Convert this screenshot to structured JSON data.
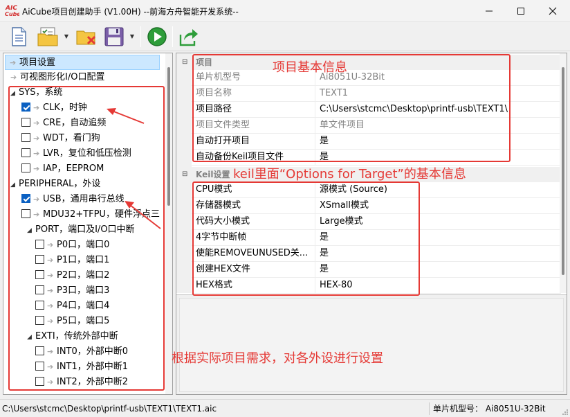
{
  "window": {
    "logo_text_top": "AIC",
    "logo_text_bottom": "Cube",
    "title": "AiCube项目创建助手 (V1.00H) --前海方舟智能开发系统--"
  },
  "toolbar": {
    "buttons": [
      {
        "name": "new-project",
        "icon": "new-document-icon"
      },
      {
        "name": "open-project",
        "icon": "open-folder-checklist-icon"
      },
      {
        "name": "close-project",
        "icon": "folder-delete-icon"
      },
      {
        "name": "save-project",
        "icon": "floppy-disk-icon"
      },
      {
        "name": "generate",
        "icon": "play-green-icon"
      },
      {
        "name": "export",
        "icon": "export-share-icon"
      }
    ]
  },
  "tree": {
    "items": [
      {
        "label": "项目设置",
        "level": 0,
        "type": "link",
        "selected": true
      },
      {
        "label": "可视图形化I/O口配置",
        "level": 0,
        "type": "link"
      },
      {
        "label": "SYS，系统",
        "level": 0,
        "type": "group"
      },
      {
        "label": "CLK，时钟",
        "level": 1,
        "type": "check",
        "checked": true
      },
      {
        "label": "CRE，自动追频",
        "level": 1,
        "type": "check",
        "checked": false
      },
      {
        "label": "WDT，看门狗",
        "level": 1,
        "type": "check",
        "checked": false
      },
      {
        "label": "LVR，复位和低压检测",
        "level": 1,
        "type": "check",
        "checked": false
      },
      {
        "label": "IAP，EEPROM",
        "level": 1,
        "type": "check",
        "checked": false
      },
      {
        "label": "PERIPHERAL，外设",
        "level": 0,
        "type": "group"
      },
      {
        "label": "USB，通用串行总线",
        "level": 1,
        "type": "check",
        "checked": true
      },
      {
        "label": "MDU32+TFPU，硬件浮点三",
        "level": 1,
        "type": "check",
        "checked": false
      },
      {
        "label": "PORT，端口及I/O口中断",
        "level": 1,
        "type": "group"
      },
      {
        "label": "P0口，端口0",
        "level": 2,
        "type": "check",
        "checked": false
      },
      {
        "label": "P1口，端口1",
        "level": 2,
        "type": "check",
        "checked": false
      },
      {
        "label": "P2口，端口2",
        "level": 2,
        "type": "check",
        "checked": false
      },
      {
        "label": "P3口，端口3",
        "level": 2,
        "type": "check",
        "checked": false
      },
      {
        "label": "P4口，端口4",
        "level": 2,
        "type": "check",
        "checked": false
      },
      {
        "label": "P5口，端口5",
        "level": 2,
        "type": "check",
        "checked": false
      },
      {
        "label": "EXTI，传统外部中断",
        "level": 1,
        "type": "group"
      },
      {
        "label": "INT0，外部中断0",
        "level": 2,
        "type": "check",
        "checked": false
      },
      {
        "label": "INT1，外部中断1",
        "level": 2,
        "type": "check",
        "checked": false
      },
      {
        "label": "INT2，外部中断2",
        "level": 2,
        "type": "check",
        "checked": false
      }
    ]
  },
  "grid": {
    "project_category": "项目",
    "project_props": [
      {
        "name": "单片机型号",
        "value": "Ai8051U-32Bit",
        "readonly": true
      },
      {
        "name": "项目名称",
        "value": "TEXT1",
        "readonly": true
      },
      {
        "name": "项目路径",
        "value": "C:\\Users\\stcmc\\Desktop\\printf-usb\\TEXT1\\",
        "readonly": false
      },
      {
        "name": "项目文件类型",
        "value": "单文件项目",
        "readonly": true
      },
      {
        "name": "自动打开项目",
        "value": "是",
        "readonly": false
      },
      {
        "name": "自动备份Keil项目文件",
        "value": "是",
        "readonly": false
      }
    ],
    "keil_category": "Keil设置",
    "keil_props": [
      {
        "name": "CPU模式",
        "value": "源模式 (Source)",
        "readonly": false
      },
      {
        "name": "存储器模式",
        "value": "XSmall模式",
        "readonly": false
      },
      {
        "name": "代码大小模式",
        "value": "Large模式",
        "readonly": false
      },
      {
        "name": "4字节中断帧",
        "value": "是",
        "readonly": false
      },
      {
        "name": "使能REMOVEUNUSED关...",
        "value": "是",
        "readonly": false
      },
      {
        "name": "创建HEX文件",
        "value": "是",
        "readonly": false
      },
      {
        "name": "HEX格式",
        "value": "HEX-80",
        "readonly": false
      }
    ]
  },
  "status": {
    "path": "C:\\Users\\stcmc\\Desktop\\printf-usb\\TEXT1\\TEXT1.aic",
    "chip": "单片机型号： Ai8051U-32Bit"
  },
  "annotations": {
    "project_info": "项目基本信息",
    "keil_info": "keil里面“Options for Target”的基本信息",
    "peripheral_info": "根据实际项目需求，对各外设进行设置"
  },
  "colors": {
    "annotation": "#e53935",
    "selection": "#cce8ff",
    "check_on": "#0a60c2"
  }
}
